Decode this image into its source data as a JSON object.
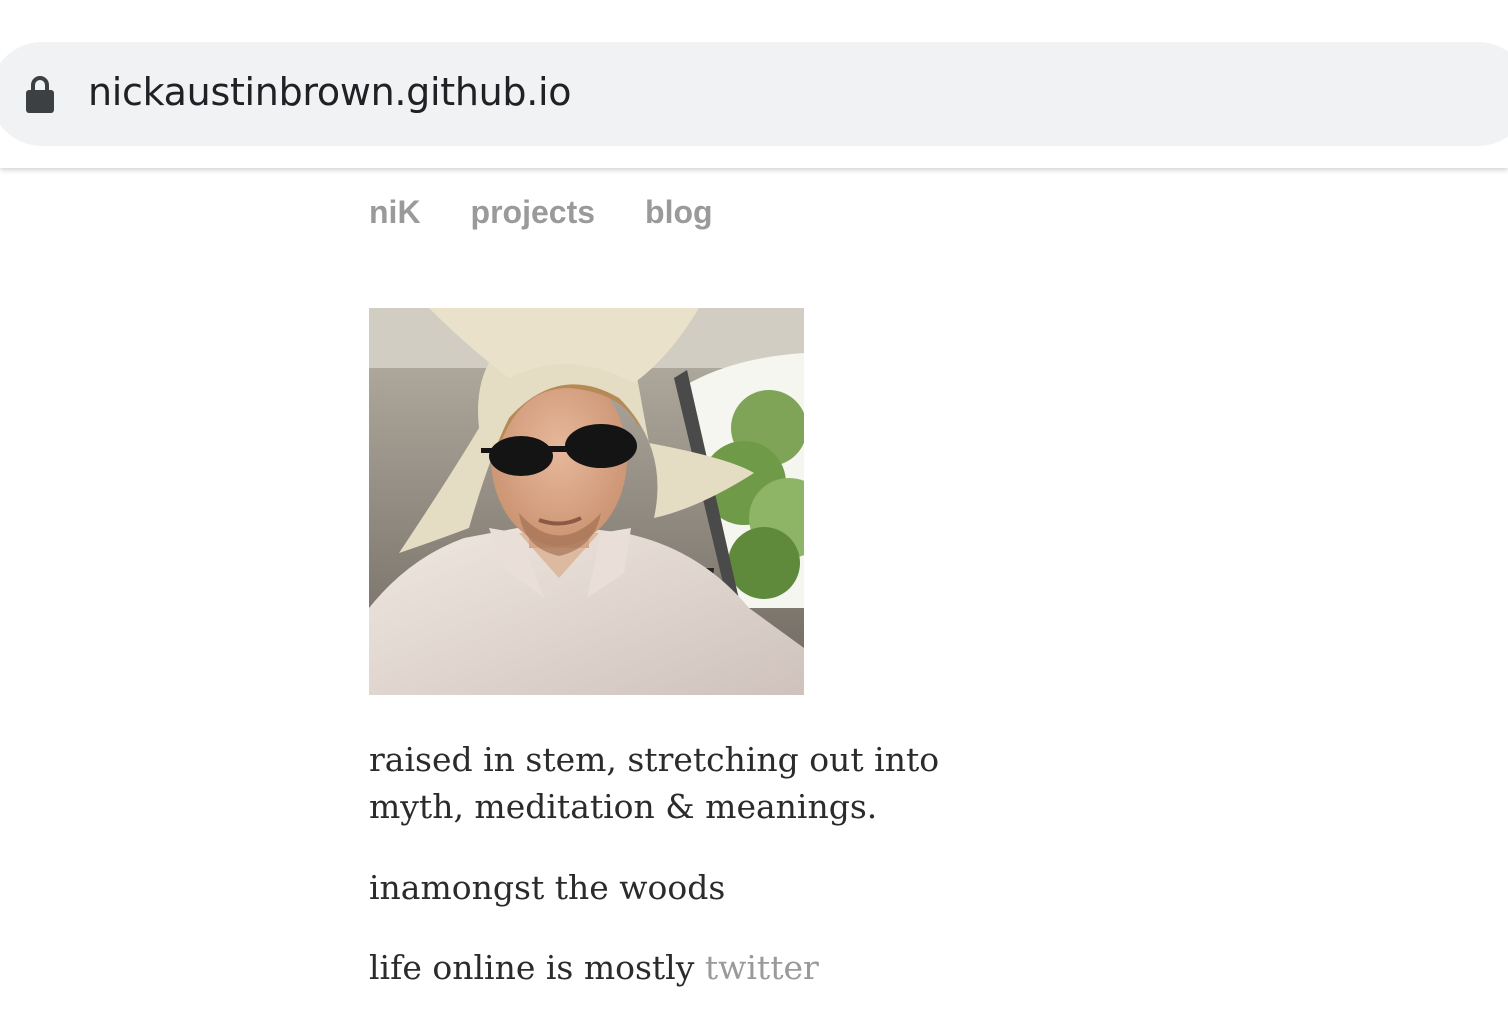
{
  "browser": {
    "url": "nickaustinbrown.github.io",
    "lock_icon": "lock-icon"
  },
  "nav": {
    "items": [
      {
        "label": "niK"
      },
      {
        "label": "projects"
      },
      {
        "label": "blog"
      }
    ]
  },
  "bio": {
    "line1": "raised in stem, stretching out into",
    "line2": "myth, meditation & meanings.",
    "line3": "inamongst the woods",
    "line4_prefix": "life online is mostly ",
    "line4_link": "twitter"
  },
  "colors": {
    "nav_text": "#9a9a9a",
    "body_text": "#2b2b2b",
    "link": "#9a9a9a",
    "omnibox_bg": "#f1f2f4"
  }
}
